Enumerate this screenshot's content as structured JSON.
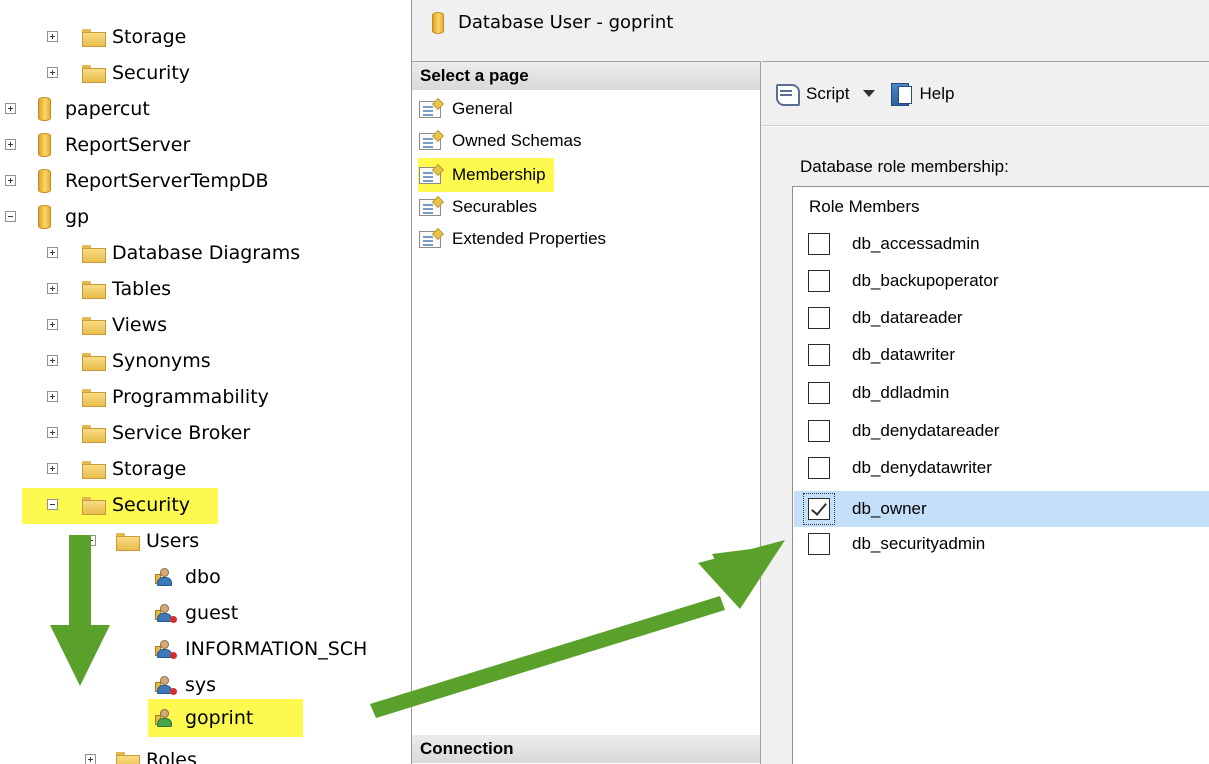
{
  "object_explorer": {
    "nodes": [
      {
        "label": "Storage",
        "type": "folder"
      },
      {
        "label": "Security",
        "type": "folder"
      },
      {
        "label": "papercut",
        "type": "database"
      },
      {
        "label": "ReportServer",
        "type": "database"
      },
      {
        "label": "ReportServerTempDB",
        "type": "database"
      },
      {
        "label": "gp",
        "type": "database"
      },
      {
        "label": "Database Diagrams",
        "type": "folder"
      },
      {
        "label": "Tables",
        "type": "folder"
      },
      {
        "label": "Views",
        "type": "folder"
      },
      {
        "label": "Synonyms",
        "type": "folder"
      },
      {
        "label": "Programmability",
        "type": "folder"
      },
      {
        "label": "Service Broker",
        "type": "folder"
      },
      {
        "label": "Storage",
        "type": "folder"
      },
      {
        "label": "Security",
        "type": "folder"
      },
      {
        "label": "Users",
        "type": "folder"
      },
      {
        "label": "dbo",
        "type": "user"
      },
      {
        "label": "guest",
        "type": "user"
      },
      {
        "label": "INFORMATION_SCH",
        "type": "user"
      },
      {
        "label": "sys",
        "type": "user"
      },
      {
        "label": "goprint",
        "type": "user"
      },
      {
        "label": "Roles",
        "type": "folder"
      }
    ]
  },
  "dialog": {
    "title": "Database User - goprint",
    "select_page_header": "Select a page",
    "pages": [
      "General",
      "Owned Schemas",
      "Membership",
      "Securables",
      "Extended Properties"
    ],
    "connection_header": "Connection",
    "toolbar": {
      "script_label": "Script",
      "help_label": "Help"
    },
    "role_membership_label": "Database role membership:",
    "role_grid_header": "Role Members",
    "roles": [
      {
        "name": "db_accessadmin",
        "checked": false
      },
      {
        "name": "db_backupoperator",
        "checked": false
      },
      {
        "name": "db_datareader",
        "checked": false
      },
      {
        "name": "db_datawriter",
        "checked": false
      },
      {
        "name": "db_ddladmin",
        "checked": false
      },
      {
        "name": "db_denydatareader",
        "checked": false
      },
      {
        "name": "db_denydatawriter",
        "checked": false
      },
      {
        "name": "db_owner",
        "checked": true
      },
      {
        "name": "db_securityadmin",
        "checked": false
      }
    ]
  },
  "colors": {
    "highlight": "#fdf94f",
    "arrow": "#5aa12c",
    "selected_row": "#c4dffa"
  }
}
